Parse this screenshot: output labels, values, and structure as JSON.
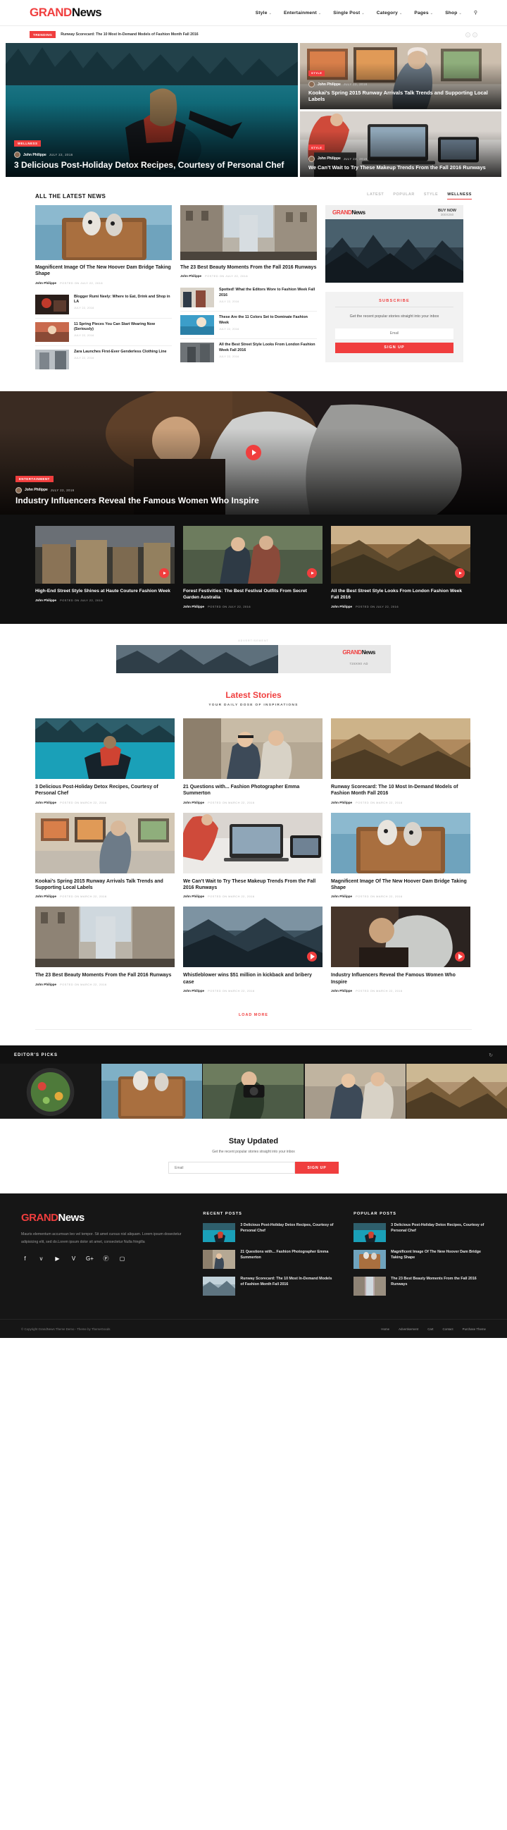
{
  "brand": {
    "part1": "GRAND",
    "part2": "News",
    "accent": "#f03e3e"
  },
  "nav": {
    "items": [
      {
        "label": "Style",
        "caret": "⌄"
      },
      {
        "label": "Entertainment",
        "caret": "⌄"
      },
      {
        "label": "Single Post",
        "caret": "⌄"
      },
      {
        "label": "Category",
        "caret": "⌄"
      },
      {
        "label": "Pages",
        "caret": "⌄"
      },
      {
        "label": "Shop",
        "caret": "⌄"
      }
    ],
    "search_icon": "⚲"
  },
  "trending": {
    "tag": "TRENDING",
    "headline": "Runway Scorecard: The 10 Most In-Demand Models of Fashion Month Fall 2016",
    "prev": "‹",
    "next": "›"
  },
  "hero": {
    "main": {
      "category": "WELLNESS",
      "author": "John Philippe",
      "date": "JULY 22, 2016",
      "title": "3 Delicious Post-Holiday Detox Recipes, Courtesy of Personal Chef"
    },
    "side": [
      {
        "category": "STYLE",
        "author": "John Philippe",
        "date": "JULY 22, 2016",
        "title": "Kookai’s Spring 2015 Runway Arrivals Talk Trends and Supporting Local Labels"
      },
      {
        "category": "STYLE",
        "author": "John Philippe",
        "date": "JULY 22, 2016",
        "title": "We Can’t Wait to Try These Makeup Trends From the Fall 2016 Runways"
      }
    ]
  },
  "latest_news": {
    "heading": "ALL THE LATEST NEWS",
    "tabs": [
      {
        "label": "LATEST",
        "active": false
      },
      {
        "label": "POPULAR",
        "active": false
      },
      {
        "label": "STYLE",
        "active": false
      },
      {
        "label": "WELLNESS",
        "active": true
      }
    ],
    "featured": [
      {
        "title": "Magnificent Image Of The New Hoover Dam Bridge Taking Shape",
        "author": "John Philippe",
        "date": "POSTED ON JULY 22, 2016"
      },
      {
        "title": "The 23 Best Beauty Moments From the Fall 2016 Runways",
        "author": "John Philippe",
        "date": "POSTED ON JULY 22, 2016"
      }
    ],
    "list_left": [
      {
        "title": "Blogger Rumi Neely: Where to Eat, Drink and Shop in LA",
        "date": "JULY 22, 2016"
      },
      {
        "title": "11 Spring Pieces You Can Start Wearing Now (Seriously)",
        "date": "JULY 22, 2016"
      },
      {
        "title": "Zara Launches First-Ever Genderless Clothing Line",
        "date": "JULY 22, 2016"
      }
    ],
    "list_right": [
      {
        "title": "Spotted! What the Editors Wore to Fashion Week Fall 2016",
        "date": "JULY 22, 2016"
      },
      {
        "title": "These Are the 11 Colors Set to Dominate Fashion Week",
        "date": "JULY 22, 2016"
      },
      {
        "title": "All the Best Street Style Looks From London Fashion Week Fall 2016",
        "date": "JULY 22, 2016"
      }
    ]
  },
  "sidebar": {
    "ad": {
      "part1": "GRAND",
      "part2": "News",
      "buy": "BUY NOW",
      "size": "300X250"
    },
    "subscribe": {
      "title": "SUBSCRIBE",
      "text": "Get the recent popular stories straight into your inbox",
      "email_placeholder": "Email",
      "button": "SIGN UP"
    }
  },
  "video": {
    "featured": {
      "category": "ENTERTAINMENT",
      "author": "John Philippe",
      "date": "JULY 22, 2016",
      "title": "Industry Influencers Reveal the Famous Women Who Inspire"
    },
    "cards": [
      {
        "title": "High-End Street Style Shines at Haute Couture Fashion Week",
        "author": "John Philippe",
        "date": "POSTED ON JULY 22, 2016"
      },
      {
        "title": "Forest Festivities: The Best Festival Outfits From Secret Garden Australia",
        "author": "John Philippe",
        "date": "POSTED ON JULY 22, 2016"
      },
      {
        "title": "All the Best Street Style Looks From London Fashion Week Fall 2016",
        "author": "John Philippe",
        "date": "POSTED ON JULY 22, 2016"
      }
    ]
  },
  "banner": {
    "label": "ADVERTISEMENT",
    "part1": "GRAND",
    "part2": "News",
    "size": "728X90 AD"
  },
  "latest_stories": {
    "title": "Latest Stories",
    "subtitle": "YOUR DAILY DOSE OF INSPIRATIONS",
    "load_more": "LOAD MORE",
    "cards": [
      {
        "title": "3 Delicious Post-Holiday Detox Recipes, Courtesy of Personal Chef",
        "author": "John Philippe",
        "date": "POSTED ON MARCH 22, 2016",
        "video": false
      },
      {
        "title": "21 Questions with... Fashion Photographer Emma Summerton",
        "author": "John Philippe",
        "date": "POSTED ON MARCH 22, 2016",
        "video": false
      },
      {
        "title": "Runway Scorecard: The 10 Most In-Demand Models of Fashion Month Fall 2016",
        "author": "John Philippe",
        "date": "POSTED ON MARCH 22, 2016",
        "video": false
      },
      {
        "title": "Kookai’s Spring 2015 Runway Arrivals Talk Trends and Supporting Local Labels",
        "author": "John Philippe",
        "date": "POSTED ON MARCH 22, 2016",
        "video": false
      },
      {
        "title": "We Can’t Wait to Try These Makeup Trends From the Fall 2016 Runways",
        "author": "John Philippe",
        "date": "POSTED ON MARCH 22, 2016",
        "video": false
      },
      {
        "title": "Magnificent Image Of The New Hoover Dam Bridge Taking Shape",
        "author": "John Philippe",
        "date": "POSTED ON MARCH 22, 2016",
        "video": false
      },
      {
        "title": "The 23 Best Beauty Moments From the Fall 2016 Runways",
        "author": "John Philippe",
        "date": "POSTED ON MARCH 22, 2016",
        "video": false
      },
      {
        "title": "Whistleblower wins $51 million in kickback and bribery case",
        "author": "John Philippe",
        "date": "POSTED ON MARCH 22, 2016",
        "video": true
      },
      {
        "title": "Industry Influencers Reveal the Famous Women Who Inspire",
        "author": "John Philippe",
        "date": "POSTED ON MARCH 22, 2016",
        "video": true
      }
    ]
  },
  "editors_picks": {
    "title": "EDITOR'S PICKS",
    "refresh_icon": "↻"
  },
  "stay_updated": {
    "title": "Stay Updated",
    "text": "Get the recent popular stories straight into your inbox",
    "email_placeholder": "Email",
    "button": "SIGN UP"
  },
  "footer": {
    "about": "Mauris elementum accumsan leo vel tempor. Sit amet cursus nisl aliquam. Lorem ipsum dosectetur adipisicing elit, sed do.Lorem ipsum dolor sit amet, consectetur Nulla fringilla",
    "social": [
      {
        "name": "facebook-icon",
        "glyph": "f"
      },
      {
        "name": "twitter-icon",
        "glyph": "ᴠ"
      },
      {
        "name": "youtube-icon",
        "glyph": "▶"
      },
      {
        "name": "vimeo-icon",
        "glyph": "V"
      },
      {
        "name": "google-plus-icon",
        "glyph": "G+"
      },
      {
        "name": "pinterest-icon",
        "glyph": "Ⓟ"
      },
      {
        "name": "instagram-icon",
        "glyph": "▢"
      }
    ],
    "recent_title": "RECENT POSTS",
    "recent": [
      {
        "title": "3 Delicious Post-Holiday Detox Recipes, Courtesy of Personal Chef"
      },
      {
        "title": "21 Questions with... Fashion Photographer Emma Summerton"
      },
      {
        "title": "Runway Scorecard: The 10 Most In-Demand Models of Fashion Month Fall 2016"
      }
    ],
    "popular_title": "POPULAR POSTS",
    "popular": [
      {
        "title": "3 Delicious Post-Holiday Detox Recipes, Courtesy of Personal Chef"
      },
      {
        "title": "Magnificent Image Of The New Hoover Dam Bridge Taking Shape"
      },
      {
        "title": "The 23 Best Beauty Moments From the Fall 2016 Runways"
      }
    ],
    "copyright": "© Copyright GrandNews Theme Demo - Theme by ThemeGoods",
    "links": [
      {
        "label": "Home"
      },
      {
        "label": "Advertisement"
      },
      {
        "label": "Cart"
      },
      {
        "label": "Contact"
      },
      {
        "label": "Purchase Theme"
      }
    ]
  }
}
